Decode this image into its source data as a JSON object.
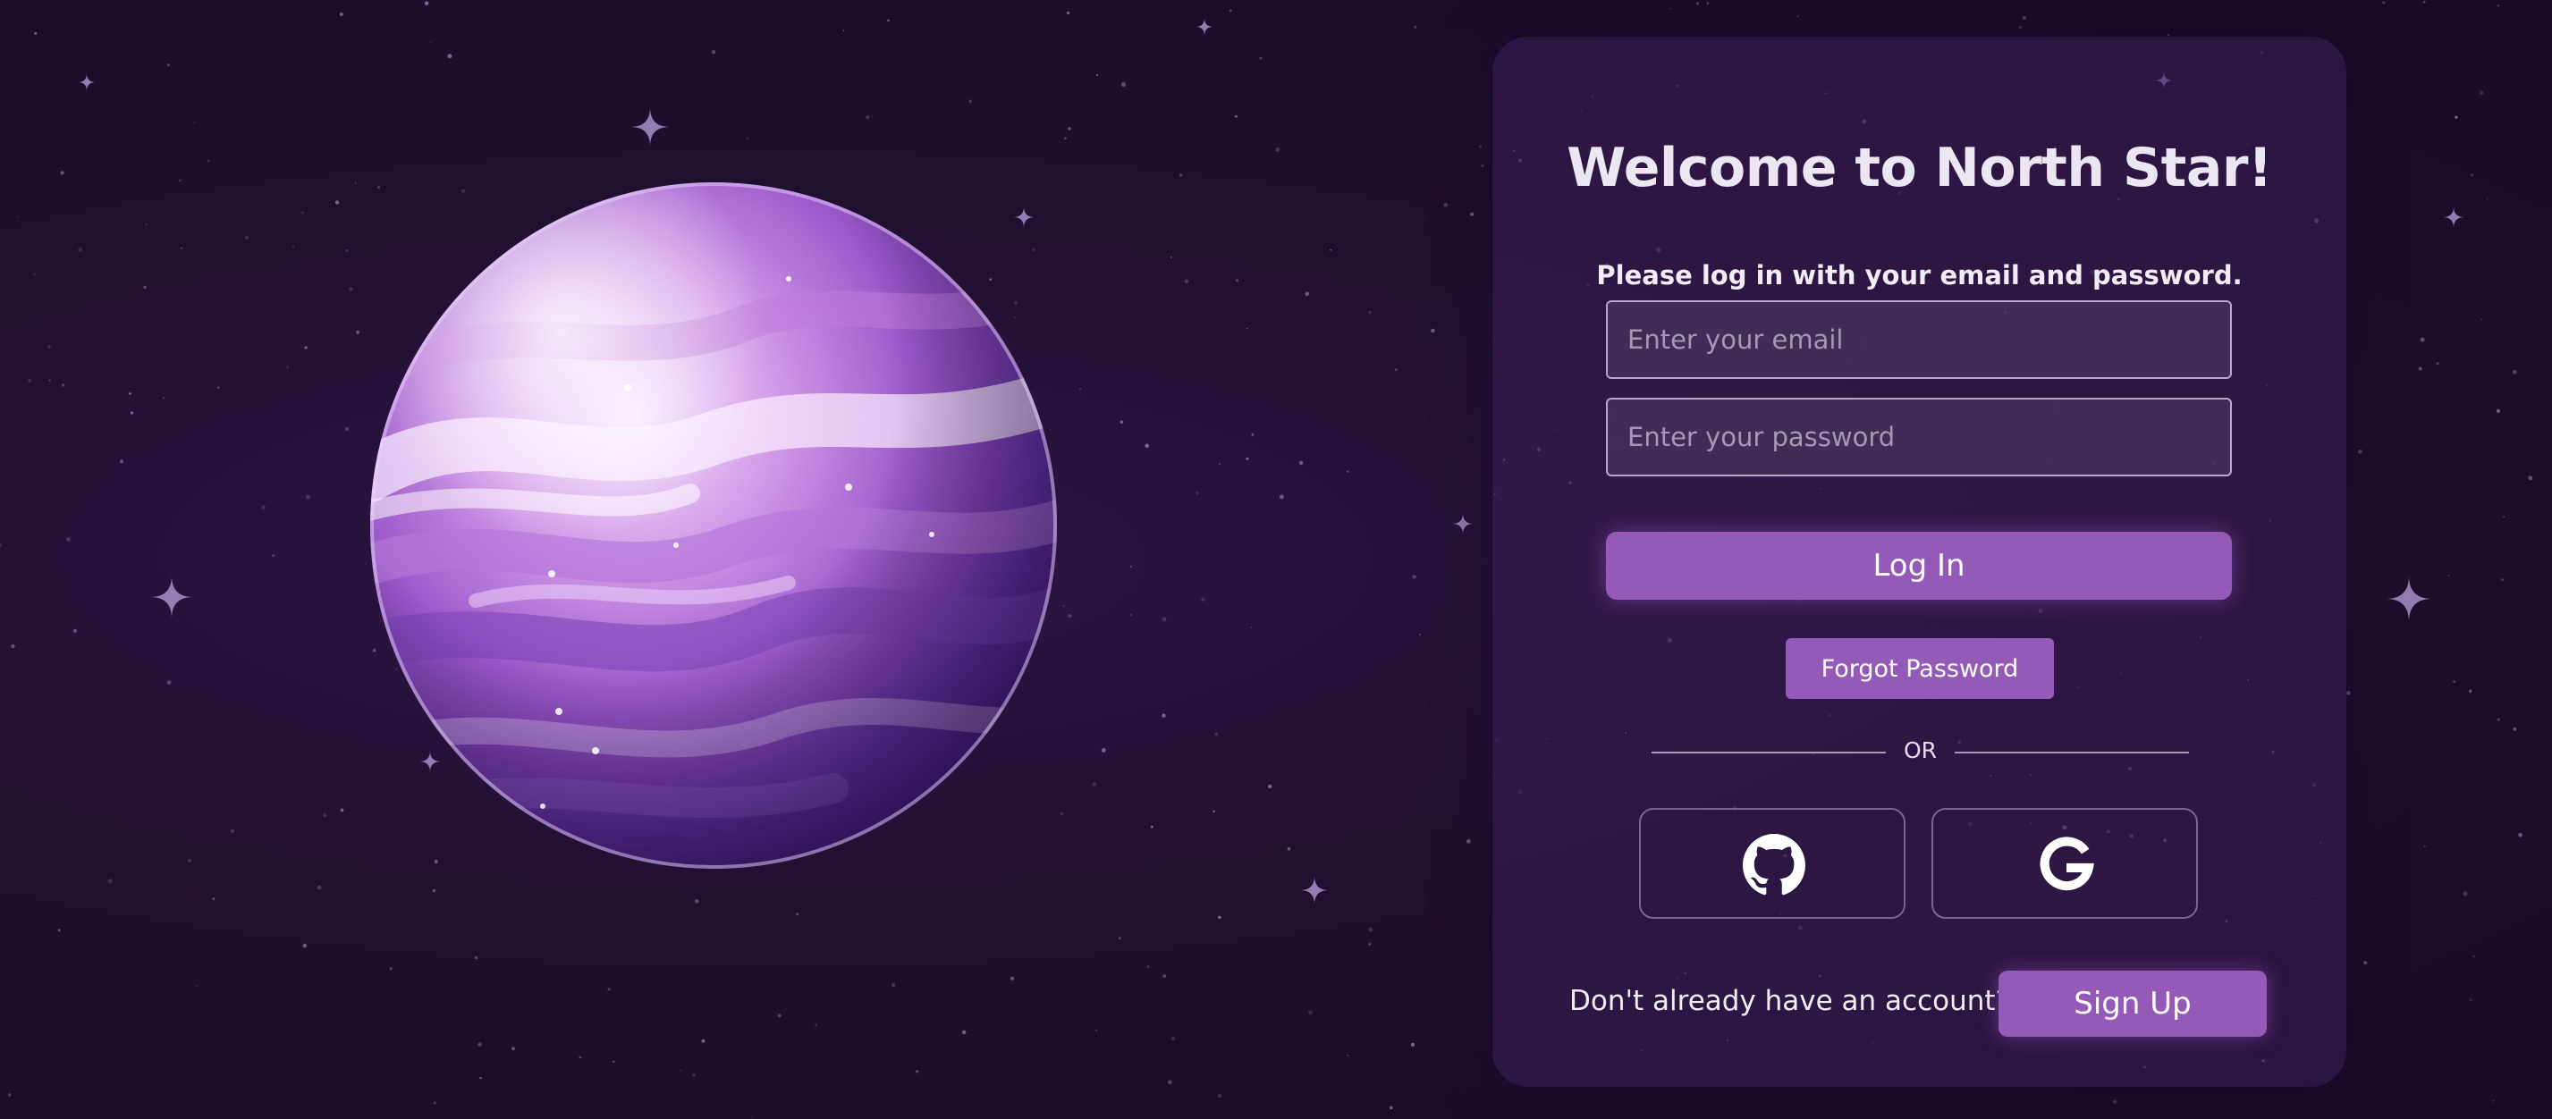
{
  "background": {
    "illustration": "purple-planet",
    "decoration": "starfield"
  },
  "colors": {
    "accent": "#9559b8",
    "panel": "#3a1e58",
    "background": "#1f0f30"
  },
  "login": {
    "title": "Welcome to North Star!",
    "subtitle": "Please log in with your email and password.",
    "email_placeholder": "Enter your email",
    "password_placeholder": "Enter your password",
    "login_label": "Log In",
    "forgot_label": "Forgot Password",
    "divider_label": "OR",
    "social": [
      {
        "icon": "github-icon"
      },
      {
        "icon": "google-icon"
      }
    ],
    "signup_prompt": "Don't already have an account?",
    "signup_label": "Sign Up"
  }
}
